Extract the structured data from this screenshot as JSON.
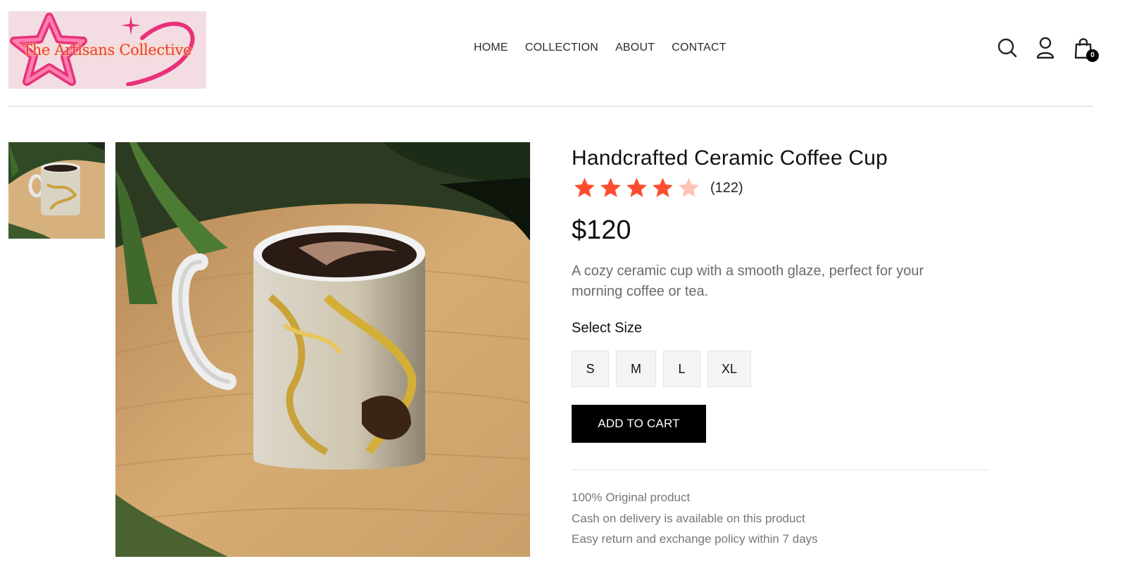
{
  "header": {
    "logo_text": "The Artisans Collective",
    "nav": [
      "HOME",
      "COLLECTION",
      "ABOUT",
      "CONTACT"
    ],
    "icons": {
      "search": "search-icon",
      "account": "user-icon",
      "cart": "shopping-bag-icon"
    },
    "cart_count": "0"
  },
  "product": {
    "title": "Handcrafted Ceramic Coffee Cup",
    "rating": 4,
    "rating_max": 5,
    "review_count": "(122)",
    "price": "$120",
    "description": "A cozy ceramic cup with a smooth glaze, perfect for your morning coffee or tea.",
    "size_label": "Select Size",
    "sizes": [
      "S",
      "M",
      "L",
      "XL"
    ],
    "add_to_cart_label": "ADD TO CART",
    "policies": [
      "100% Original product",
      "Cash on delivery is available on this product",
      "Easy return and exchange policy within 7 days"
    ]
  },
  "colors": {
    "star_filled": "#ff4c2e",
    "star_empty": "#ffc2b4",
    "logo_pink": "#e8317a",
    "logo_bg": "#f3dde3"
  }
}
